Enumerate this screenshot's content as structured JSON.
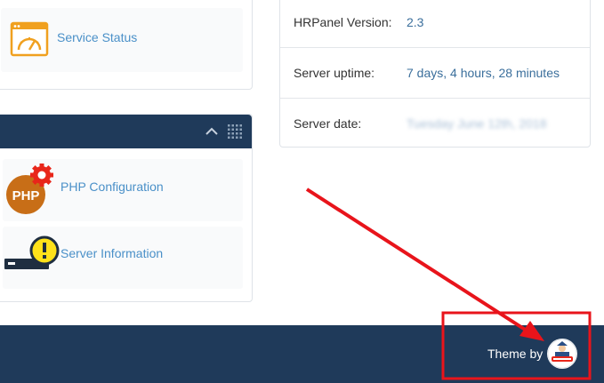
{
  "left_top_panel": {
    "service_status_label": "Service Status",
    "service_status_icon": "gauge-window-icon"
  },
  "left_bottom_panel": {
    "collapse_icon": "chevron-up-icon",
    "grid_icon": "drag-grid-icon",
    "php_config_label": "PHP Configuration",
    "php_icon_text": "PHP",
    "server_info_label": "Server Information"
  },
  "info_table": {
    "rows": [
      {
        "key": "HRPanel Version:",
        "value": "2.3"
      },
      {
        "key": "Server uptime:",
        "value": "7 days, 4 hours, 28 minutes"
      },
      {
        "key": "Server date:",
        "value": "Tuesday June 12th, 2018"
      }
    ]
  },
  "footer": {
    "theme_by_label": "Theme by",
    "logo_icon": "theme-author-logo"
  },
  "colors": {
    "header_navy": "#1f3a5a",
    "link_blue": "#4a90c8",
    "annotation_red": "#e8141b",
    "php_orange": "#c86e17",
    "warning_yellow": "#ffe21a"
  }
}
